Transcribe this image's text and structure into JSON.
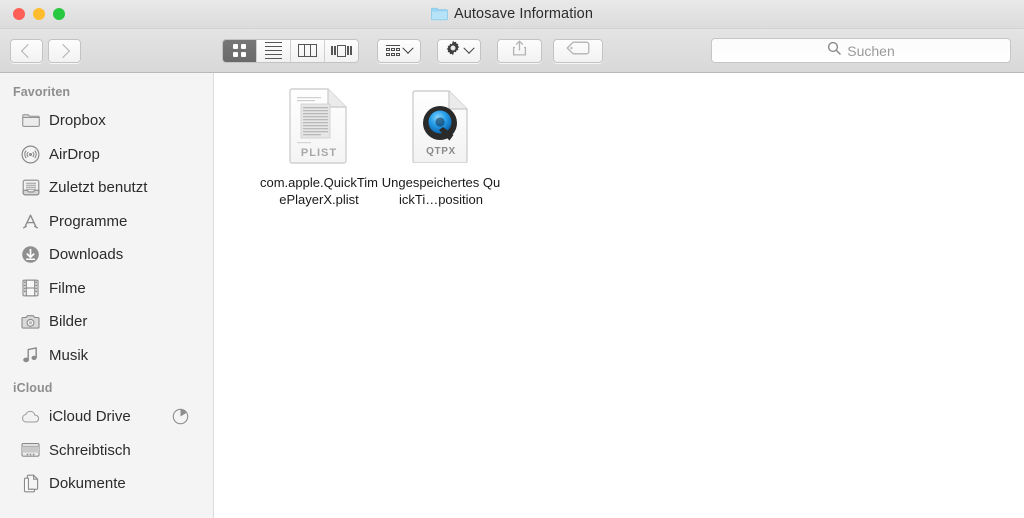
{
  "window": {
    "title": "Autosave Information",
    "title_icon": "folder-icon",
    "traffic_lights": {
      "close": {
        "name": "close-button",
        "color": "#ff5f57"
      },
      "minimize": {
        "name": "minimize-button",
        "color": "#febc2e"
      },
      "maximize": {
        "name": "maximize-button",
        "color": "#28c840"
      }
    }
  },
  "toolbar": {
    "back": {
      "label": "",
      "icon": "chevron-left-icon"
    },
    "forward": {
      "label": "",
      "icon": "chevron-right-icon"
    },
    "view_modes": [
      {
        "name": "icon-view",
        "icon": "grid-icon",
        "selected": true
      },
      {
        "name": "list-view",
        "icon": "list-icon",
        "selected": false
      },
      {
        "name": "column-view",
        "icon": "columns-icon",
        "selected": false
      },
      {
        "name": "gallery-view",
        "icon": "coverflow-icon",
        "selected": false
      }
    ],
    "arrange": {
      "name": "arrange-by-button",
      "icon": "arrange-icon"
    },
    "action": {
      "name": "action-menu-button",
      "icon": "gear-icon"
    },
    "share": {
      "name": "share-button",
      "icon": "share-icon",
      "enabled": false
    },
    "tags": {
      "name": "tags-button",
      "icon": "tag-icon",
      "enabled": false
    }
  },
  "search": {
    "placeholder": "Suchen",
    "value": "",
    "icon": "search-icon"
  },
  "sidebar": {
    "sections": [
      {
        "header": "Favoriten",
        "items": [
          {
            "label": "Dropbox",
            "icon": "folder-icon"
          },
          {
            "label": "AirDrop",
            "icon": "airdrop-icon"
          },
          {
            "label": "Zuletzt benutzt",
            "icon": "recents-icon"
          },
          {
            "label": "Programme",
            "icon": "applications-icon"
          },
          {
            "label": "Downloads",
            "icon": "downloads-icon"
          },
          {
            "label": "Filme",
            "icon": "movies-icon"
          },
          {
            "label": "Bilder",
            "icon": "pictures-icon"
          },
          {
            "label": "Musik",
            "icon": "music-icon"
          }
        ]
      },
      {
        "header": "iCloud",
        "items": [
          {
            "label": "iCloud Drive",
            "icon": "cloud-icon",
            "badge": "sync-progress-icon"
          },
          {
            "label": "Schreibtisch",
            "icon": "desktop-icon"
          },
          {
            "label": "Dokumente",
            "icon": "documents-icon"
          }
        ]
      }
    ]
  },
  "content": {
    "files": [
      {
        "name": "com.apple.QuickTimePlayerX.plist",
        "icon": "plist-document-icon",
        "badge_text": "PLIST"
      },
      {
        "name": "Ungespeichertes QuickTi…position",
        "icon": "quicktime-document-icon",
        "badge_text": "QTPX"
      }
    ]
  }
}
